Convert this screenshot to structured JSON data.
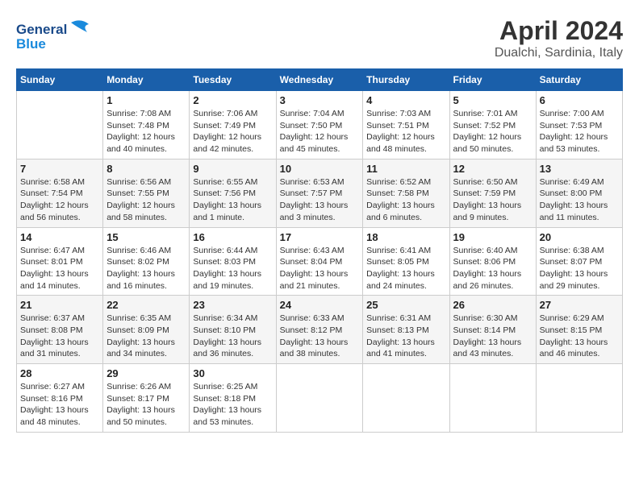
{
  "header": {
    "logo": {
      "general": "General",
      "blue": "Blue"
    },
    "title": "April 2024",
    "subtitle": "Dualchi, Sardinia, Italy"
  },
  "weekdays": [
    "Sunday",
    "Monday",
    "Tuesday",
    "Wednesday",
    "Thursday",
    "Friday",
    "Saturday"
  ],
  "weeks": [
    [
      {
        "day": "",
        "info": ""
      },
      {
        "day": "1",
        "info": "Sunrise: 7:08 AM\nSunset: 7:48 PM\nDaylight: 12 hours\nand 40 minutes."
      },
      {
        "day": "2",
        "info": "Sunrise: 7:06 AM\nSunset: 7:49 PM\nDaylight: 12 hours\nand 42 minutes."
      },
      {
        "day": "3",
        "info": "Sunrise: 7:04 AM\nSunset: 7:50 PM\nDaylight: 12 hours\nand 45 minutes."
      },
      {
        "day": "4",
        "info": "Sunrise: 7:03 AM\nSunset: 7:51 PM\nDaylight: 12 hours\nand 48 minutes."
      },
      {
        "day": "5",
        "info": "Sunrise: 7:01 AM\nSunset: 7:52 PM\nDaylight: 12 hours\nand 50 minutes."
      },
      {
        "day": "6",
        "info": "Sunrise: 7:00 AM\nSunset: 7:53 PM\nDaylight: 12 hours\nand 53 minutes."
      }
    ],
    [
      {
        "day": "7",
        "info": "Sunrise: 6:58 AM\nSunset: 7:54 PM\nDaylight: 12 hours\nand 56 minutes."
      },
      {
        "day": "8",
        "info": "Sunrise: 6:56 AM\nSunset: 7:55 PM\nDaylight: 12 hours\nand 58 minutes."
      },
      {
        "day": "9",
        "info": "Sunrise: 6:55 AM\nSunset: 7:56 PM\nDaylight: 13 hours\nand 1 minute."
      },
      {
        "day": "10",
        "info": "Sunrise: 6:53 AM\nSunset: 7:57 PM\nDaylight: 13 hours\nand 3 minutes."
      },
      {
        "day": "11",
        "info": "Sunrise: 6:52 AM\nSunset: 7:58 PM\nDaylight: 13 hours\nand 6 minutes."
      },
      {
        "day": "12",
        "info": "Sunrise: 6:50 AM\nSunset: 7:59 PM\nDaylight: 13 hours\nand 9 minutes."
      },
      {
        "day": "13",
        "info": "Sunrise: 6:49 AM\nSunset: 8:00 PM\nDaylight: 13 hours\nand 11 minutes."
      }
    ],
    [
      {
        "day": "14",
        "info": "Sunrise: 6:47 AM\nSunset: 8:01 PM\nDaylight: 13 hours\nand 14 minutes."
      },
      {
        "day": "15",
        "info": "Sunrise: 6:46 AM\nSunset: 8:02 PM\nDaylight: 13 hours\nand 16 minutes."
      },
      {
        "day": "16",
        "info": "Sunrise: 6:44 AM\nSunset: 8:03 PM\nDaylight: 13 hours\nand 19 minutes."
      },
      {
        "day": "17",
        "info": "Sunrise: 6:43 AM\nSunset: 8:04 PM\nDaylight: 13 hours\nand 21 minutes."
      },
      {
        "day": "18",
        "info": "Sunrise: 6:41 AM\nSunset: 8:05 PM\nDaylight: 13 hours\nand 24 minutes."
      },
      {
        "day": "19",
        "info": "Sunrise: 6:40 AM\nSunset: 8:06 PM\nDaylight: 13 hours\nand 26 minutes."
      },
      {
        "day": "20",
        "info": "Sunrise: 6:38 AM\nSunset: 8:07 PM\nDaylight: 13 hours\nand 29 minutes."
      }
    ],
    [
      {
        "day": "21",
        "info": "Sunrise: 6:37 AM\nSunset: 8:08 PM\nDaylight: 13 hours\nand 31 minutes."
      },
      {
        "day": "22",
        "info": "Sunrise: 6:35 AM\nSunset: 8:09 PM\nDaylight: 13 hours\nand 34 minutes."
      },
      {
        "day": "23",
        "info": "Sunrise: 6:34 AM\nSunset: 8:10 PM\nDaylight: 13 hours\nand 36 minutes."
      },
      {
        "day": "24",
        "info": "Sunrise: 6:33 AM\nSunset: 8:12 PM\nDaylight: 13 hours\nand 38 minutes."
      },
      {
        "day": "25",
        "info": "Sunrise: 6:31 AM\nSunset: 8:13 PM\nDaylight: 13 hours\nand 41 minutes."
      },
      {
        "day": "26",
        "info": "Sunrise: 6:30 AM\nSunset: 8:14 PM\nDaylight: 13 hours\nand 43 minutes."
      },
      {
        "day": "27",
        "info": "Sunrise: 6:29 AM\nSunset: 8:15 PM\nDaylight: 13 hours\nand 46 minutes."
      }
    ],
    [
      {
        "day": "28",
        "info": "Sunrise: 6:27 AM\nSunset: 8:16 PM\nDaylight: 13 hours\nand 48 minutes."
      },
      {
        "day": "29",
        "info": "Sunrise: 6:26 AM\nSunset: 8:17 PM\nDaylight: 13 hours\nand 50 minutes."
      },
      {
        "day": "30",
        "info": "Sunrise: 6:25 AM\nSunset: 8:18 PM\nDaylight: 13 hours\nand 53 minutes."
      },
      {
        "day": "",
        "info": ""
      },
      {
        "day": "",
        "info": ""
      },
      {
        "day": "",
        "info": ""
      },
      {
        "day": "",
        "info": ""
      }
    ]
  ]
}
